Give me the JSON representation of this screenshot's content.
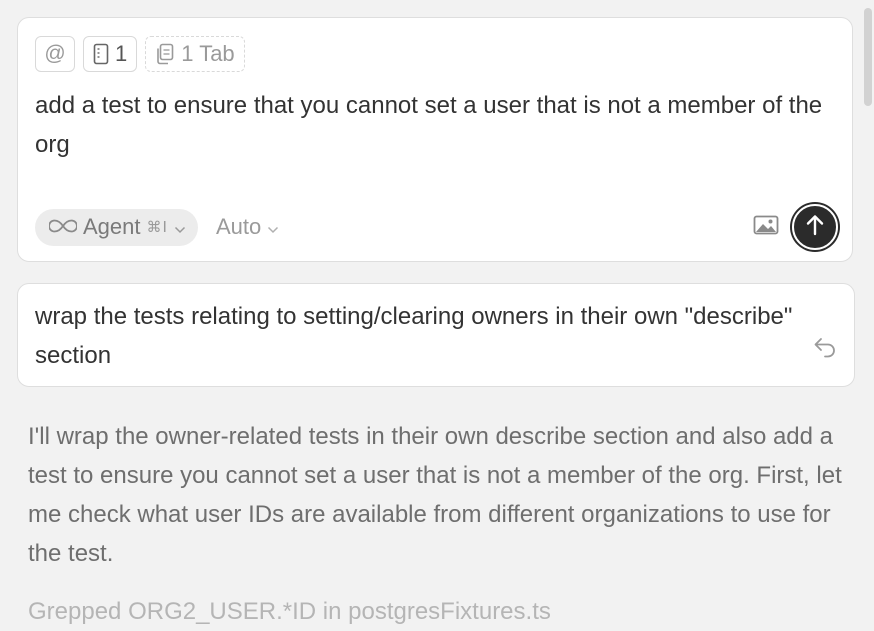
{
  "composer": {
    "context_chips": {
      "mention_symbol": "@",
      "files_count": "1",
      "tabs_label": "1 Tab"
    },
    "prompt_text": "add a test to ensure that you cannot set a user that is not a member of the org",
    "mode": {
      "label": "Agent",
      "shortcut": "⌘I"
    },
    "model": {
      "label": "Auto"
    },
    "icons": {
      "mode": "infinity-icon",
      "image": "image-icon",
      "send": "arrow-up-icon"
    }
  },
  "previous_message": {
    "text": "wrap the tests relating to setting/clearing owners in their own \"describe\" section",
    "revert_icon": "undo-arrow-icon"
  },
  "assistant": {
    "response_text": "I'll wrap the owner-related tests in their own describe section and also add a test to ensure you cannot set a user that is not a member of the org. First, let me check what user IDs are available from different organizations to use for the test.",
    "tool_status": "Grepped ORG2_USER.*ID in postgresFixtures.ts"
  },
  "colors": {
    "background": "#f2f2f2",
    "card": "#ffffff",
    "send_button": "#2b2b2b"
  }
}
